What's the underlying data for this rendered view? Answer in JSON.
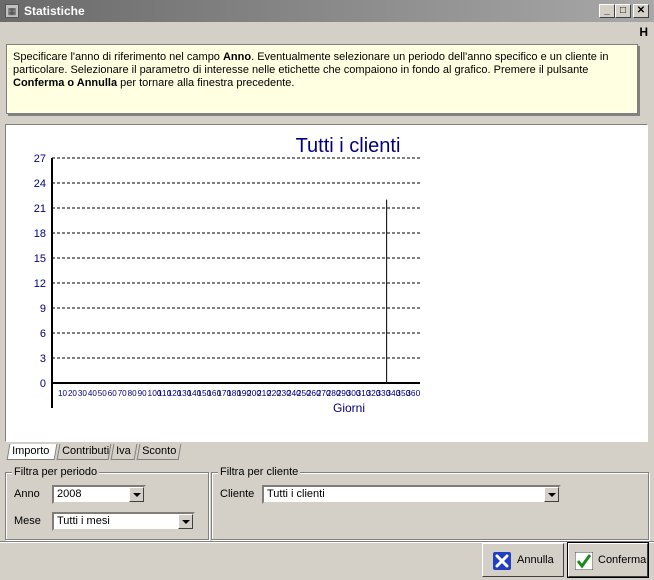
{
  "window": {
    "title": "Statistiche",
    "app_icon": "app-icon",
    "min": "_",
    "max": "□",
    "close": "✕"
  },
  "menu": {
    "h_label": "H"
  },
  "info": {
    "p1": "Specificare l'anno di riferimento nel campo ",
    "b1": "Anno",
    "p2": ". Eventualmente selezionare un periodo dell'anno specifico e un cliente in particolare. Selezionare il parametro di interesse nelle etichette che compaiono in fondo al grafico. Premere il pulsante ",
    "b2": "Conferma o Annulla",
    "p3": " per tornare alla finestra precedente."
  },
  "chart_data": {
    "type": "bar",
    "title": "Tutti i clienti",
    "xlabel": "Giorni",
    "ylabel": "",
    "ylim": [
      0,
      27
    ],
    "y_ticks": [
      0,
      3,
      6,
      9,
      12,
      15,
      18,
      21,
      24,
      27
    ],
    "x_tick_labels": [
      "10",
      "20",
      "30",
      "40",
      "50",
      "60",
      "70",
      "80",
      "90",
      "100",
      "110",
      "120",
      "130",
      "140",
      "150",
      "160",
      "170",
      "180",
      "190",
      "200",
      "210",
      "220",
      "230",
      "240",
      "250",
      "260",
      "270",
      "280",
      "290",
      "300",
      "310",
      "320",
      "330",
      "340",
      "350",
      "360"
    ],
    "x_range": [
      1,
      365
    ],
    "series": [
      {
        "values": [
          {
            "x": 332,
            "y": 22
          }
        ]
      }
    ],
    "grid": "horizontal dashed",
    "title_color": "#000080",
    "tick_color": "#000080"
  },
  "tabs": [
    {
      "label": "Importo",
      "active": true
    },
    {
      "label": "Contributi",
      "active": false
    },
    {
      "label": "Iva",
      "active": false
    },
    {
      "label": "Sconto",
      "active": false
    }
  ],
  "filtro_periodo": {
    "title": "Filtra per periodo",
    "anno_label": "Anno",
    "anno_value": "2008",
    "mese_label": "Mese",
    "mese_value": "Tutti i mesi"
  },
  "filtro_cliente": {
    "title": "Filtra per cliente",
    "cliente_label": "Cliente",
    "cliente_value": "Tutti i clienti"
  },
  "buttons": {
    "annulla": "Annulla",
    "conferma": "Conferma"
  }
}
